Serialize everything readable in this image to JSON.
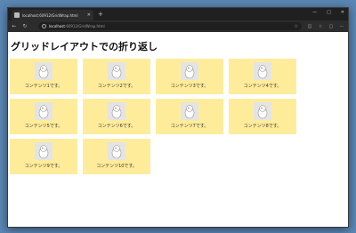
{
  "browser": {
    "tab_title": "localhost:60912/GridWrap.html",
    "address_host": "localhost",
    "address_rest": ":60912/GridWrap.html",
    "new_tab": "+",
    "controls": [
      "—",
      "□",
      "✕"
    ]
  },
  "page": {
    "title": "グリッドレイアウトでの折り返し",
    "items": [
      {
        "label": "コンテンツ1です。"
      },
      {
        "label": "コンテンツ2です。"
      },
      {
        "label": "コンテンツ3です。"
      },
      {
        "label": "コンテンツ4です。"
      },
      {
        "label": "コンテンツ5です。"
      },
      {
        "label": "コンテンツ6です。"
      },
      {
        "label": "コンテンツ7です。"
      },
      {
        "label": "コンテンツ8です。"
      },
      {
        "label": "コンテンツ9です。"
      },
      {
        "label": "コンテンツ10です。"
      }
    ]
  },
  "colors": {
    "card_background": "#ffec9a",
    "desktop": "#5b87b5"
  }
}
